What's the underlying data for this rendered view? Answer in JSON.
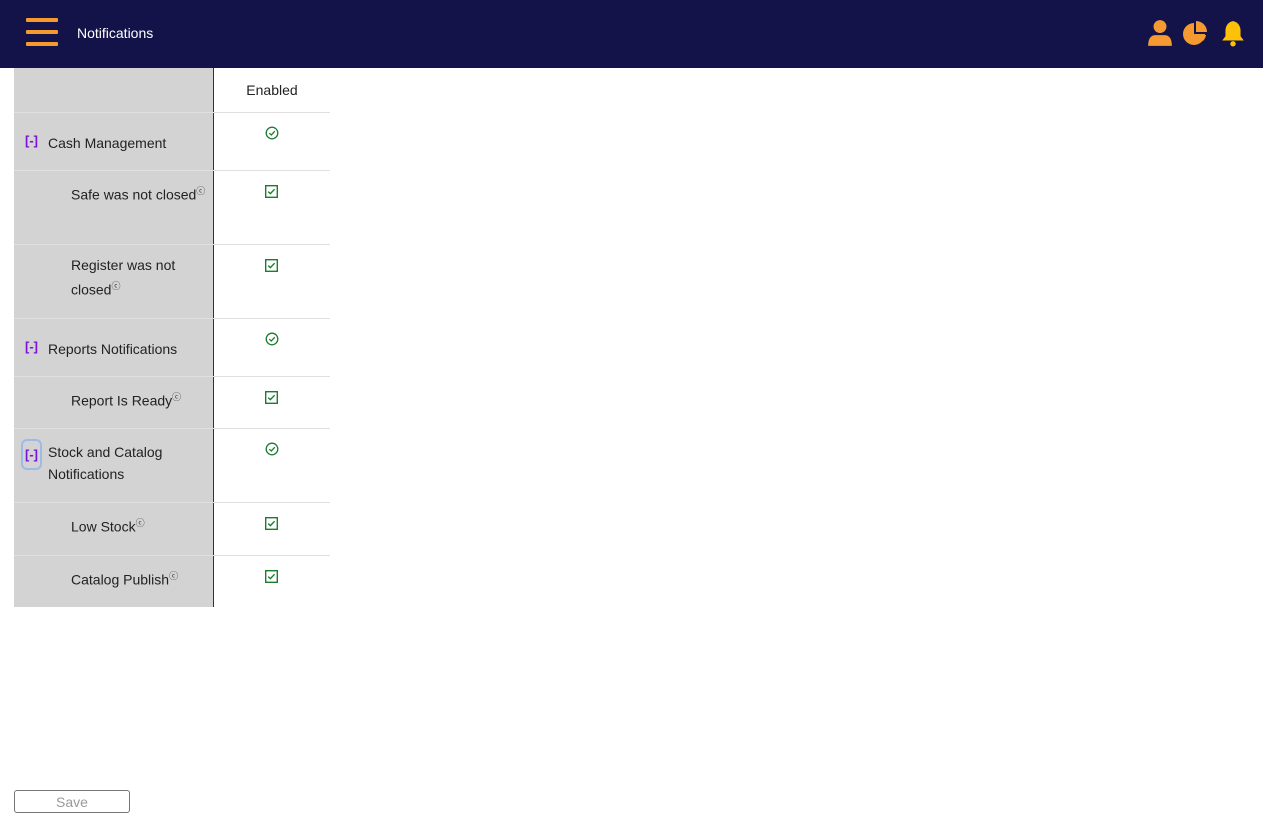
{
  "header": {
    "title": "Notifications",
    "colors": {
      "bar": "#13134a",
      "accent": "#f49a31",
      "bell": "#ffc107"
    }
  },
  "table": {
    "column_header": "Enabled",
    "help_glyph": "?",
    "toggle_label": "[-]",
    "groups": [
      {
        "label": "Cash Management",
        "enabled": true,
        "items": [
          {
            "label": "Safe was not closed",
            "checked": true
          },
          {
            "label": "Register was not closed",
            "checked": true
          }
        ]
      },
      {
        "label": "Reports Notifications",
        "enabled": true,
        "items": [
          {
            "label": "Report Is Ready",
            "checked": true
          }
        ]
      },
      {
        "label": "Stock and Catalog Notifications",
        "enabled": true,
        "focused": true,
        "items": [
          {
            "label": "Low Stock",
            "checked": true
          },
          {
            "label": "Catalog Publish",
            "checked": true
          }
        ]
      }
    ]
  },
  "footer": {
    "save_label": "Save"
  }
}
